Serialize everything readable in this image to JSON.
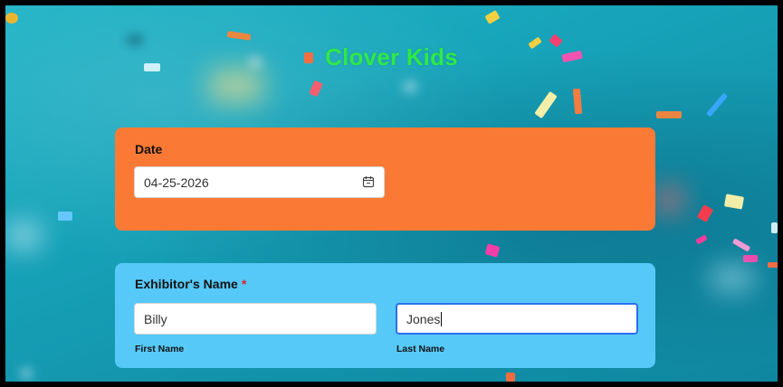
{
  "page": {
    "title": "Clover Kids",
    "title_color": "#2ee94a"
  },
  "date_section": {
    "label": "Date",
    "value": "04-25-2026",
    "icon": "calendar-icon",
    "background": "#fa7a35"
  },
  "exhibitor_section": {
    "label": "Exhibitor's Name",
    "required_mark": "*",
    "background": "#56c9f8",
    "first_name": {
      "value": "Billy",
      "sublabel": "First Name"
    },
    "last_name": {
      "value": "Jones",
      "sublabel": "Last Name",
      "focused": true
    }
  },
  "colors": {
    "background": "#17a4ba",
    "focus_ring": "#2b6ff0",
    "required": "#e0262b"
  }
}
